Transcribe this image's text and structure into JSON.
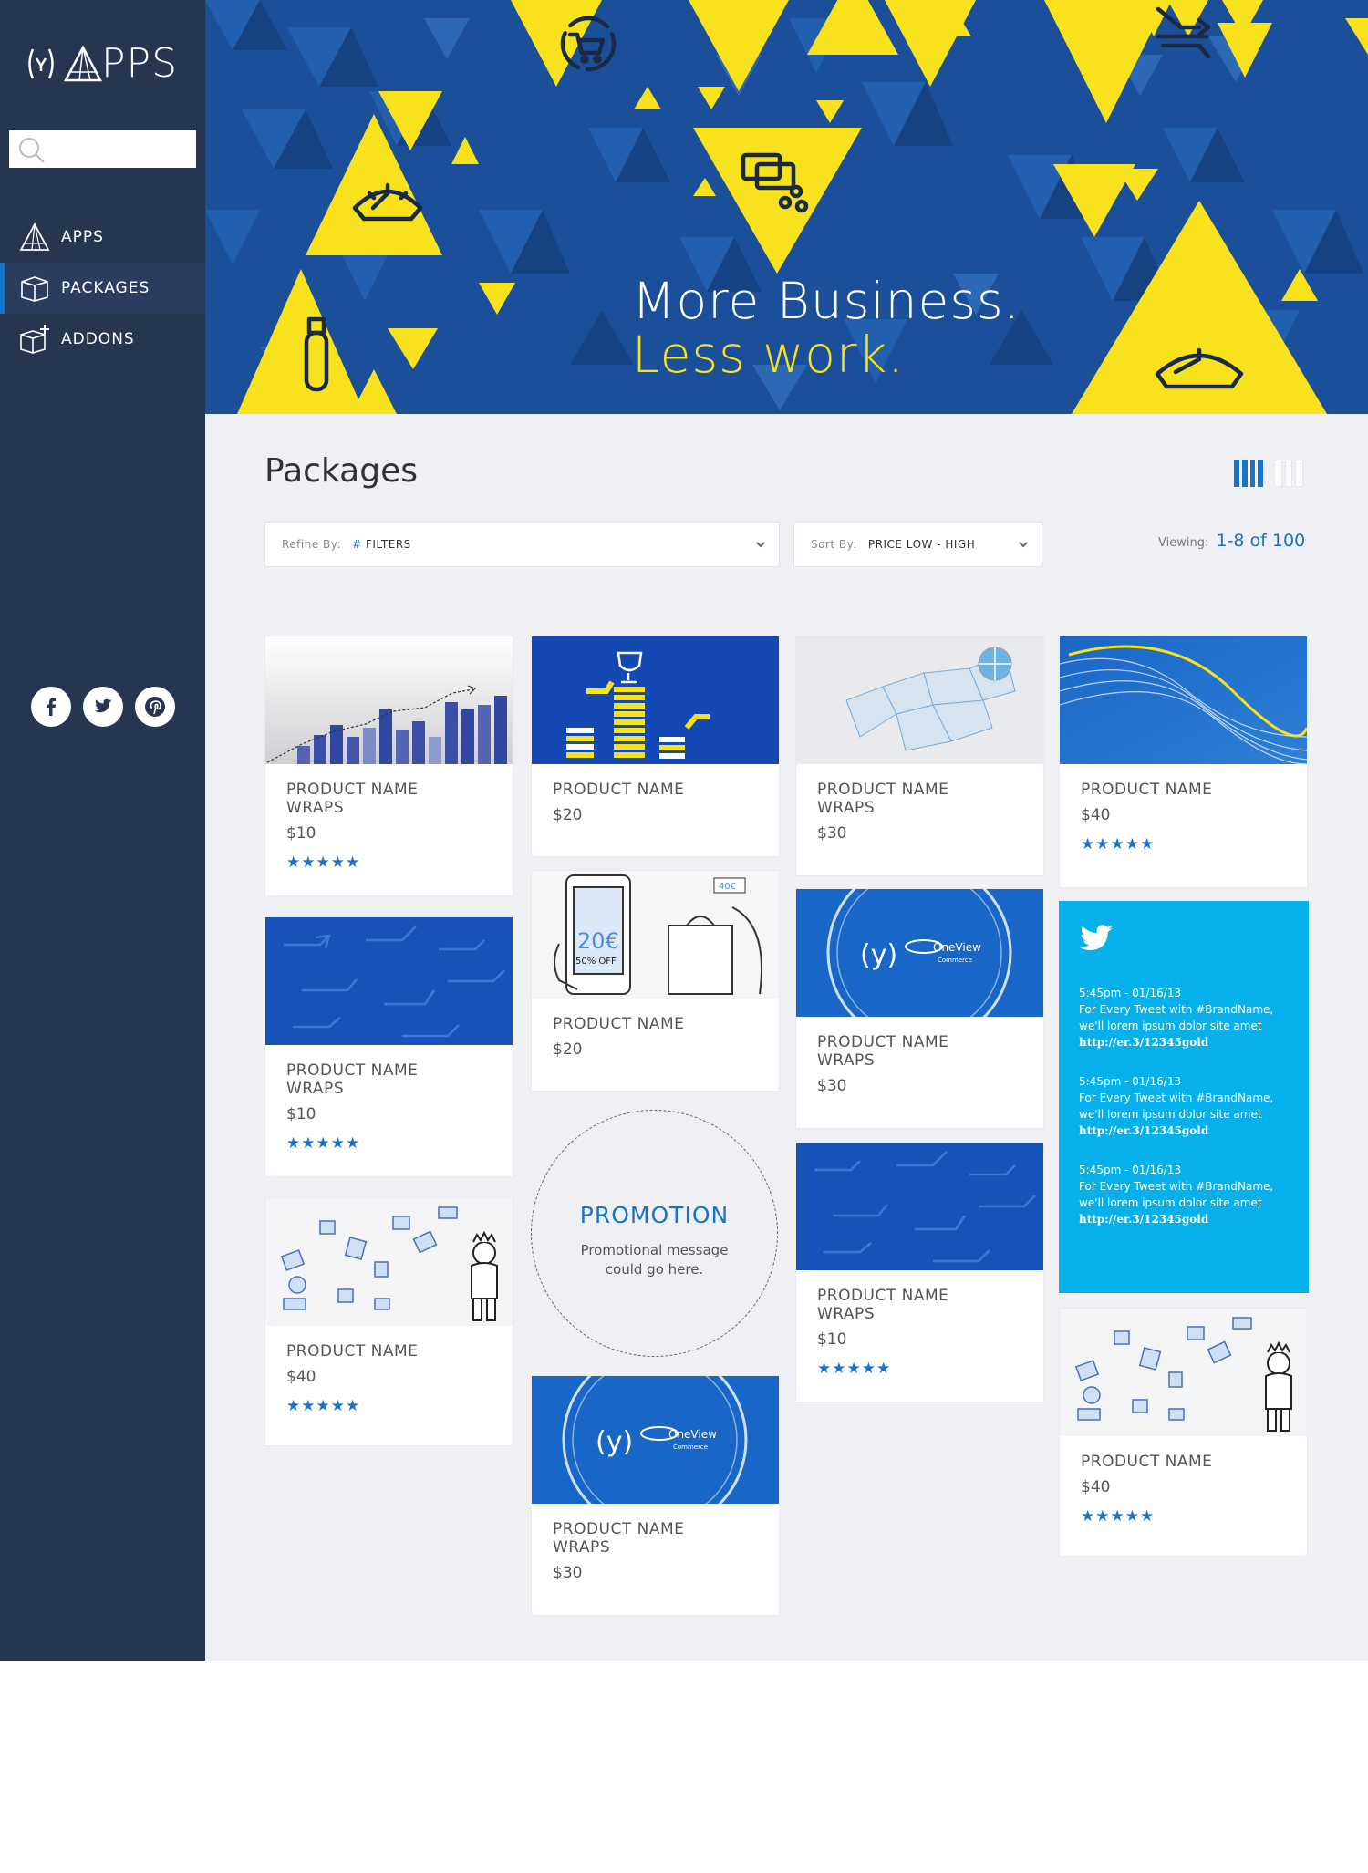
{
  "sidebar": {
    "brand": "PPS",
    "search": {
      "placeholder": ""
    },
    "nav": [
      {
        "label": "APPS",
        "icon": "pyramid-icon"
      },
      {
        "label": "PACKAGES",
        "icon": "box-icon"
      },
      {
        "label": "ADDONS",
        "icon": "box-plus-icon"
      }
    ],
    "social": [
      "facebook-icon",
      "twitter-icon",
      "pinterest-icon"
    ]
  },
  "hero": {
    "line1": "More Business.",
    "line2": "Less work."
  },
  "page": {
    "title": "Packages",
    "refine": {
      "label": "Refine By:",
      "hash": "#",
      "value": "FILTERS"
    },
    "sort": {
      "label": "Sort By:",
      "value": "PRICE LOW - HIGH"
    },
    "viewing": {
      "label": "Viewing:",
      "range": "1-8 of 100"
    }
  },
  "cards": [
    {
      "name": "PRODUCT NAME",
      "sub": "WRAPS",
      "price": "$10",
      "rating": 5,
      "stars": "★★★★★"
    },
    {
      "name": "PRODUCT NAME",
      "sub": "WRAPS",
      "price": "$10",
      "rating": 5,
      "stars": "★★★★★"
    },
    {
      "name": "PRODUCT NAME",
      "sub": "",
      "price": "$40",
      "rating": 5,
      "stars": "★★★★★"
    },
    {
      "name": "PRODUCT NAME",
      "sub": "",
      "price": "$20"
    },
    {
      "name": "PRODUCT NAME",
      "sub": "",
      "price": "$20"
    },
    {
      "name": "PRODUCT NAME",
      "sub": "WRAPS",
      "price": "$30"
    },
    {
      "name": "PRODUCT NAME",
      "sub": "WRAPS",
      "price": "$30"
    },
    {
      "name": "PRODUCT NAME",
      "sub": "WRAPS",
      "price": "$30"
    },
    {
      "name": "PRODUCT NAME",
      "sub": "WRAPS",
      "price": "$10",
      "rating": 5,
      "stars": "★★★★★"
    },
    {
      "name": "PRODUCT NAME",
      "sub": "",
      "price": "$40",
      "rating": 5,
      "stars": "★★★★★"
    },
    {
      "name": "PRODUCT NAME",
      "sub": "",
      "price": "$40",
      "rating": 5,
      "stars": "★★★★★"
    }
  ],
  "promo": {
    "title": "PROMOTION",
    "message": "Promotional message could go here."
  },
  "tweets": [
    {
      "time": "5:45pm - 01/16/13",
      "text": "For Every Tweet with #BrandName, we'll lorem ipsum dolor site amet",
      "link": "http://er.3/12345gold"
    },
    {
      "time": "5:45pm - 01/16/13",
      "text": "For Every Tweet with #BrandName, we'll lorem ipsum dolor site amet",
      "link": "http://er.3/12345gold"
    },
    {
      "time": "5:45pm - 01/16/13",
      "text": "For Every Tweet with #BrandName, we'll lorem ipsum dolor site amet",
      "link": "http://er.3/12345gold"
    }
  ],
  "colors": {
    "sidebar": "#263550",
    "accent": "#1a73c6",
    "hero_yellow": "#f8e11d",
    "tweet_bg": "#06b0ea"
  }
}
